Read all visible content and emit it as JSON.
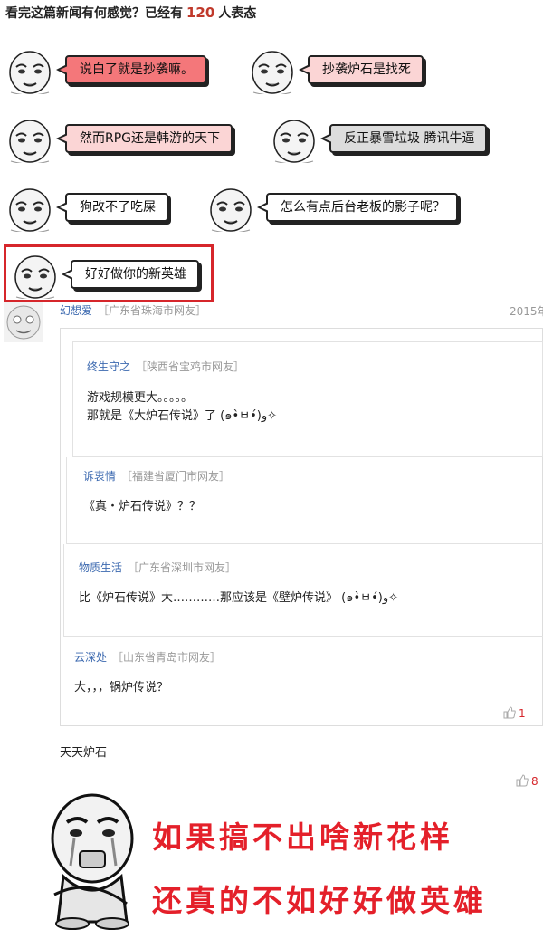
{
  "header": {
    "prefix": "看完这篇新闻有何感觉？已经有",
    "count": "120",
    "suffix": "人表态"
  },
  "reactions": [
    {
      "label": "说白了就是抄袭嘛。",
      "style": "red"
    },
    {
      "label": "抄袭炉石是找死",
      "style": "pink"
    },
    {
      "label": "然而RPG还是韩游的天下",
      "style": "pink"
    },
    {
      "label": "反正暴雪垃圾 腾讯牛逼",
      "style": "gray"
    },
    {
      "label": "狗改不了吃屎",
      "style": "white"
    },
    {
      "label": "怎么有点后台老板的影子呢？",
      "style": "white"
    },
    {
      "label": "好好做你的新英雄",
      "style": "white",
      "selected": true
    }
  ],
  "comment": {
    "username": "幻想爱",
    "location": "［广东省珠海市网友］",
    "date": "2015年",
    "quotes": [
      {
        "username": "终生守之",
        "location": "［陕西省宝鸡市网友］",
        "lines": [
          "游戏规模更大。。。。。",
          "那就是《大炉石传说》了 (๑•̀ㅂ•́)و✧"
        ]
      },
      {
        "username": "诉衷情",
        "location": "［福建省厦门市网友］",
        "lines": [
          "《真・炉石传说》？？"
        ]
      },
      {
        "username": "物质生活",
        "location": "［广东省深圳市网友］",
        "lines": [
          "比《炉石传说》大…………那应该是《壁炉传说》 (๑•̀ㅂ•́)و✧"
        ]
      },
      {
        "username": "云深处",
        "location": "［山东省青岛市网友］",
        "lines": [
          "大，，，锅炉传说？"
        ]
      }
    ],
    "quote_likes": "1",
    "text": "天天炉石",
    "likes": "8"
  },
  "caption": {
    "line1": "如果搞不出啥新花样",
    "line2": "还真的不如好好做英雄"
  },
  "colors": {
    "accent_red": "#d6262b",
    "link_blue": "#3d6ab0",
    "caption_red": "#e4202a"
  }
}
